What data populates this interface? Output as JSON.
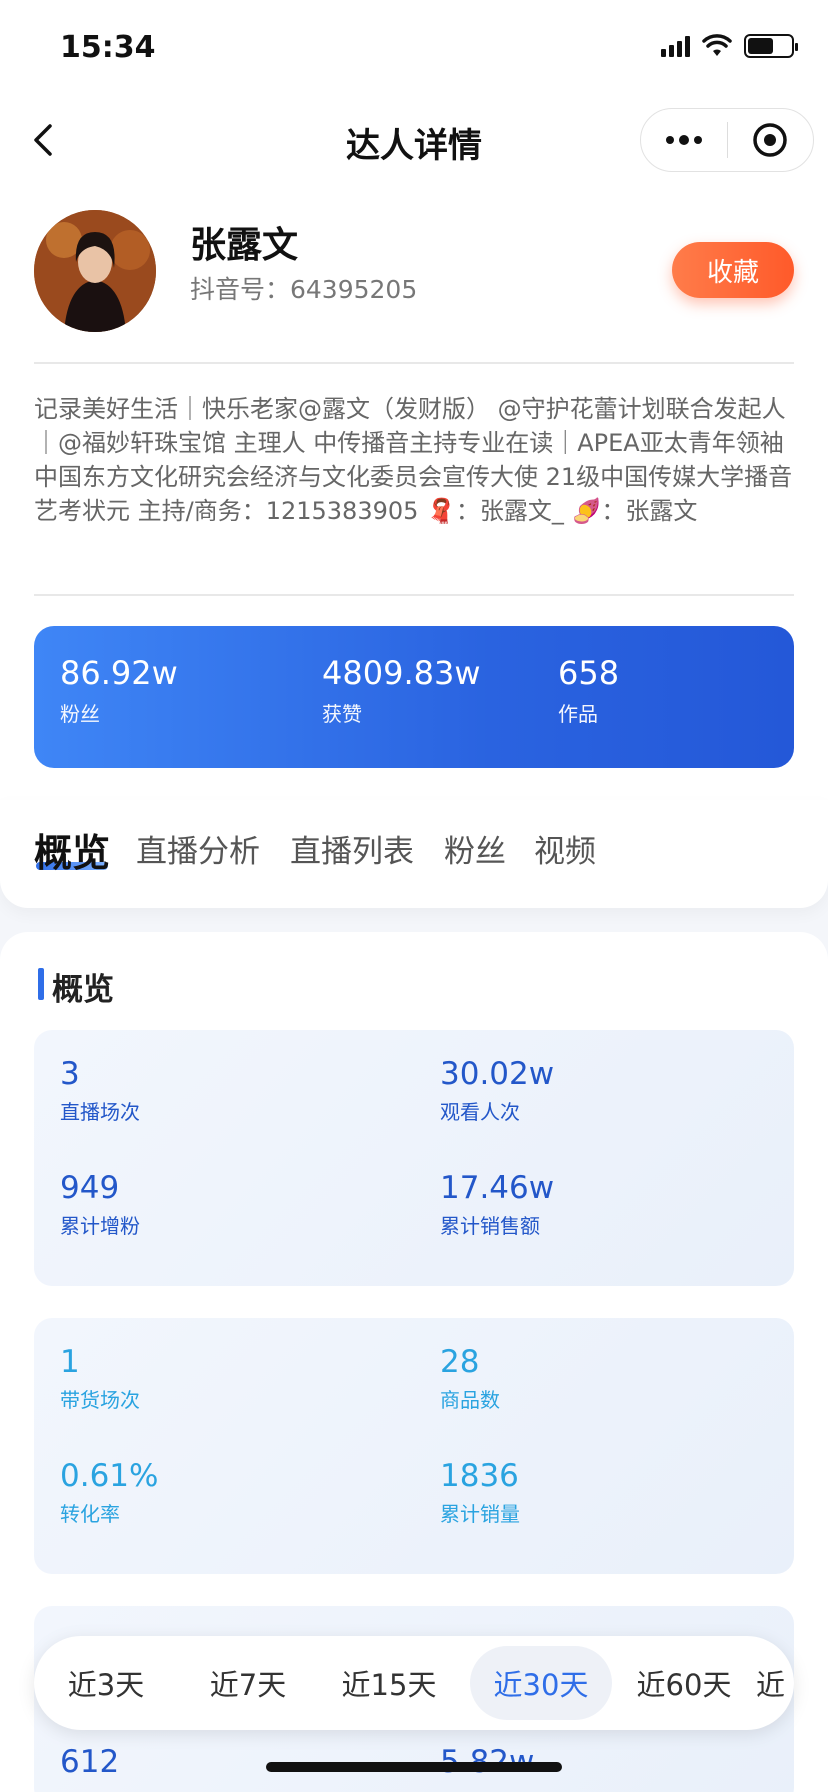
{
  "status_bar": {
    "time": "15:34"
  },
  "header": {
    "title": "达人详情"
  },
  "profile": {
    "name": "张露文",
    "douyin_id_label": "抖音号：64395205",
    "favorite_label": "收藏",
    "bio": "记录美好生活｜快乐老家@露文（发财版） @守护花蕾计划联合发起人｜@福妙轩珠宝馆 主理人 中传播音主持专业在读｜APEA亚太青年领袖 中国东方文化研究会经济与文化委员会宣传大使 21级中国传媒大学播音艺考状元 主持/商务：1215383905 🧣：张露文_ 🍠：张露文"
  },
  "stats": [
    {
      "value": "86.92w",
      "label": "粉丝"
    },
    {
      "value": "4809.83w",
      "label": "获赞"
    },
    {
      "value": "658",
      "label": "作品"
    }
  ],
  "tabs": [
    {
      "label": "概览"
    },
    {
      "label": "直播分析"
    },
    {
      "label": "直播列表"
    },
    {
      "label": "粉丝"
    },
    {
      "label": "视频"
    }
  ],
  "section": {
    "title": "概览"
  },
  "overview_block1": [
    {
      "value": "3",
      "label": "直播场次"
    },
    {
      "value": "30.02w",
      "label": "观看人次"
    },
    {
      "value": "949",
      "label": "累计增粉"
    },
    {
      "value": "17.46w",
      "label": "累计销售额"
    }
  ],
  "overview_block2": [
    {
      "value": "1",
      "label": "带货场次"
    },
    {
      "value": "28",
      "label": "商品数"
    },
    {
      "value": "0.61%",
      "label": "转化率"
    },
    {
      "value": "1836",
      "label": "累计销量"
    }
  ],
  "overview_block3": [
    {
      "value": "612"
    },
    {
      "value": "5.82w"
    }
  ],
  "date_range": {
    "options": [
      "近3天",
      "近7天",
      "近15天",
      "近30天",
      "近60天",
      "近"
    ],
    "selected": "近30天"
  },
  "colors": {
    "accent": "#2f6ee8",
    "favorite": "#ff5a2a",
    "light_metric": "#2aa3e0"
  }
}
